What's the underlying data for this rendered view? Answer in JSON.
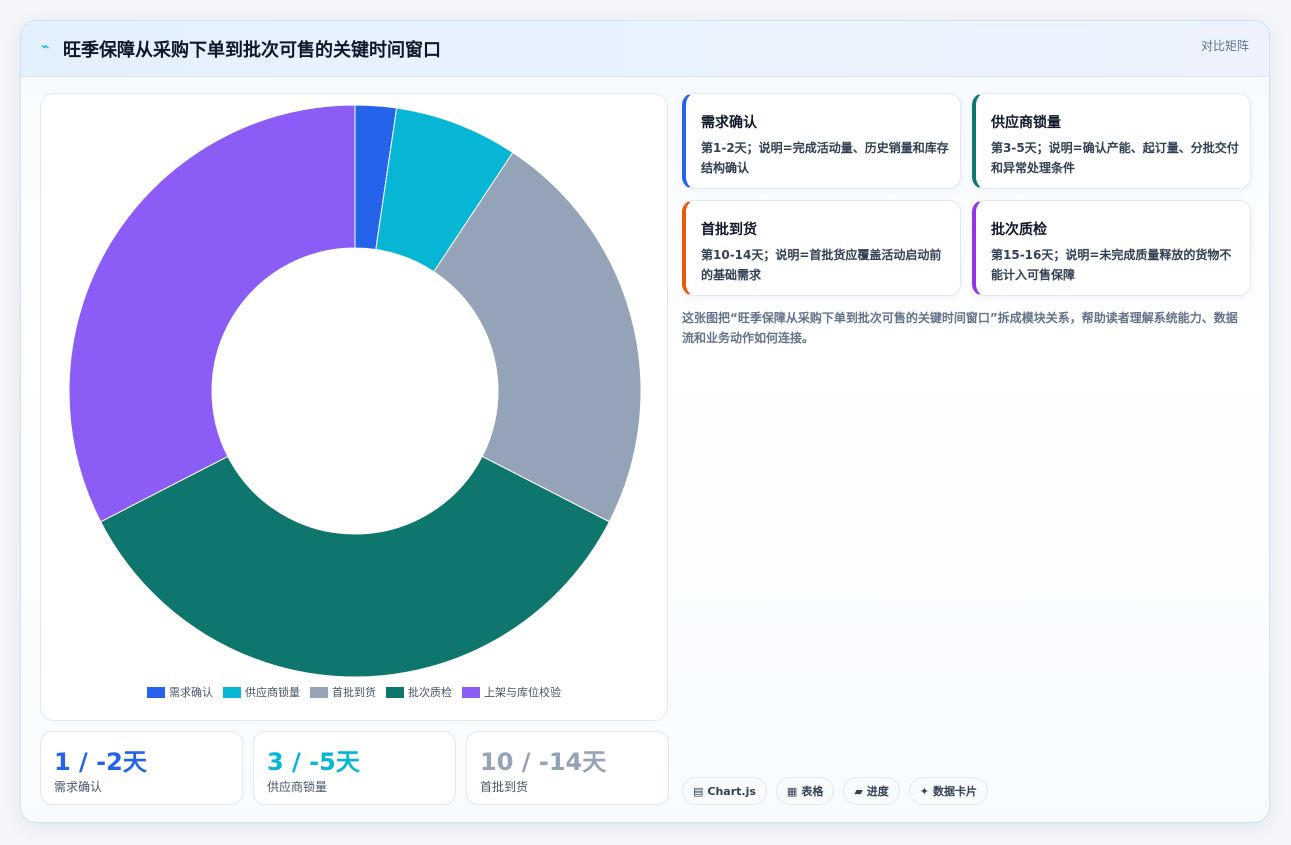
{
  "header": {
    "icon": "bolt-icon",
    "title": "旺季保障从采购下单到批次可售的关键时间窗口",
    "mode_label": "对比矩阵"
  },
  "chart_data": {
    "type": "pie",
    "subtype": "doughnut",
    "title": "",
    "categories": [
      "需求确认",
      "供应商锁量",
      "首批到货",
      "批次质检",
      "上架与库位校验"
    ],
    "values": [
      1,
      3,
      10,
      15,
      14
    ],
    "colors": [
      "#2563eb",
      "#06b6d4",
      "#94a3b8",
      "#0f766e",
      "#8b5cf6"
    ],
    "legend_position": "bottom"
  },
  "stats": [
    {
      "value": "1 / -2天",
      "label": "需求确认",
      "color": "#2563eb"
    },
    {
      "value": "3 / -5天",
      "label": "供应商锁量",
      "color": "#06b6d4"
    },
    {
      "value": "10 / -14天",
      "label": "首批到货",
      "color": "#94a3b8"
    }
  ],
  "modules": [
    {
      "title": "需求确认",
      "desc": "第1-2天；说明=完成活动量、历史销量和库存结构确认",
      "color": "#2563eb"
    },
    {
      "title": "供应商锁量",
      "desc": "第3-5天；说明=确认产能、起订量、分批交付和异常处理条件",
      "color": "#0f766e"
    },
    {
      "title": "首批到货",
      "desc": "第10-14天；说明=首批货应覆盖活动启动前的基础需求",
      "color": "#ea580c"
    },
    {
      "title": "批次质检",
      "desc": "第15-16天；说明=未完成质量释放的货物不能计入可售保障",
      "color": "#9333ea"
    }
  ],
  "summary": "这张图把“旺季保障从采购下单到批次可售的关键时间窗口”拆成模块关系，帮助读者理解系统能力、数据流和业务动作如何连接。",
  "chips": [
    {
      "icon": "chart-icon",
      "glyph": "▤",
      "label": "Chart.js"
    },
    {
      "icon": "table-icon",
      "glyph": "▦",
      "label": "表格"
    },
    {
      "icon": "progress-icon",
      "glyph": "▰",
      "label": "进度"
    },
    {
      "icon": "sparkle-icon",
      "glyph": "✦",
      "label": "数据卡片"
    }
  ]
}
